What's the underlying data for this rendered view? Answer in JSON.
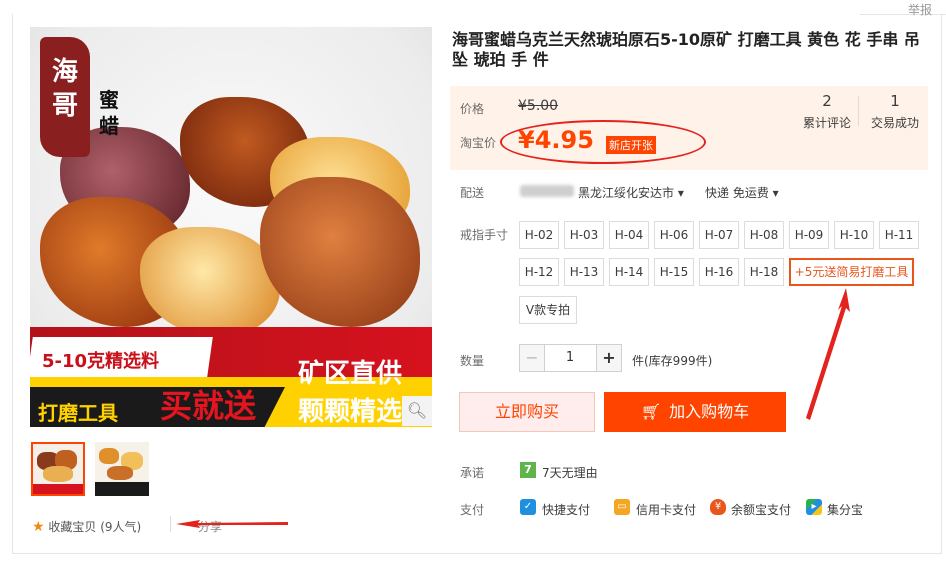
{
  "report": "举报",
  "product": {
    "title": "海哥蜜蜡乌克兰天然琥珀原石5-10原矿 打磨工具 黄色 花 手串 吊坠 琥珀 手 件",
    "image_text": {
      "logo_main": "海哥",
      "logo_sub": "蜜蜡",
      "line1": "5-10克精选料",
      "line2": "打磨工具",
      "line3": "买就送",
      "line4": "矿区直供",
      "line5": "颗颗精选"
    }
  },
  "price": {
    "label_price": "价格",
    "old": "¥5.00",
    "label_promo": "淘宝价",
    "new": "¥4.95",
    "badge": "新店开张"
  },
  "stats": [
    {
      "num": "2",
      "caption": "累计评论"
    },
    {
      "num": "1",
      "caption": "交易成功"
    }
  ],
  "shipping": {
    "label": "配送",
    "destination": "黑龙江绥化安达市",
    "method": "快递 免运费"
  },
  "ring": {
    "label": "戒指手寸",
    "options": [
      "H-02",
      "H-03",
      "H-04",
      "H-06",
      "H-07",
      "H-08",
      "H-09",
      "H-10",
      "H-11",
      "H-12",
      "H-13",
      "H-14",
      "H-15",
      "H-16",
      "H-18",
      "+5元送简易打磨工具",
      "V款专拍"
    ]
  },
  "quantity": {
    "label": "数量",
    "minus": "−",
    "value": "1",
    "plus": "+",
    "stock": "件(库存999件)"
  },
  "buttons": {
    "buy_now": "立即购买",
    "add_cart": "加入购物车"
  },
  "promise": {
    "label": "承诺",
    "icon_text": "7",
    "text": "7天无理由"
  },
  "payment": {
    "label": "支付",
    "methods": [
      "快捷支付",
      "信用卡支付",
      "余额宝支付",
      "集分宝"
    ]
  },
  "favorite": {
    "text": "收藏宝贝 (9人气)",
    "share": "分享"
  },
  "colors": {
    "accent": "#ff4400",
    "price_bg": "#fff2e8",
    "annotation_red": "#e3231c"
  }
}
